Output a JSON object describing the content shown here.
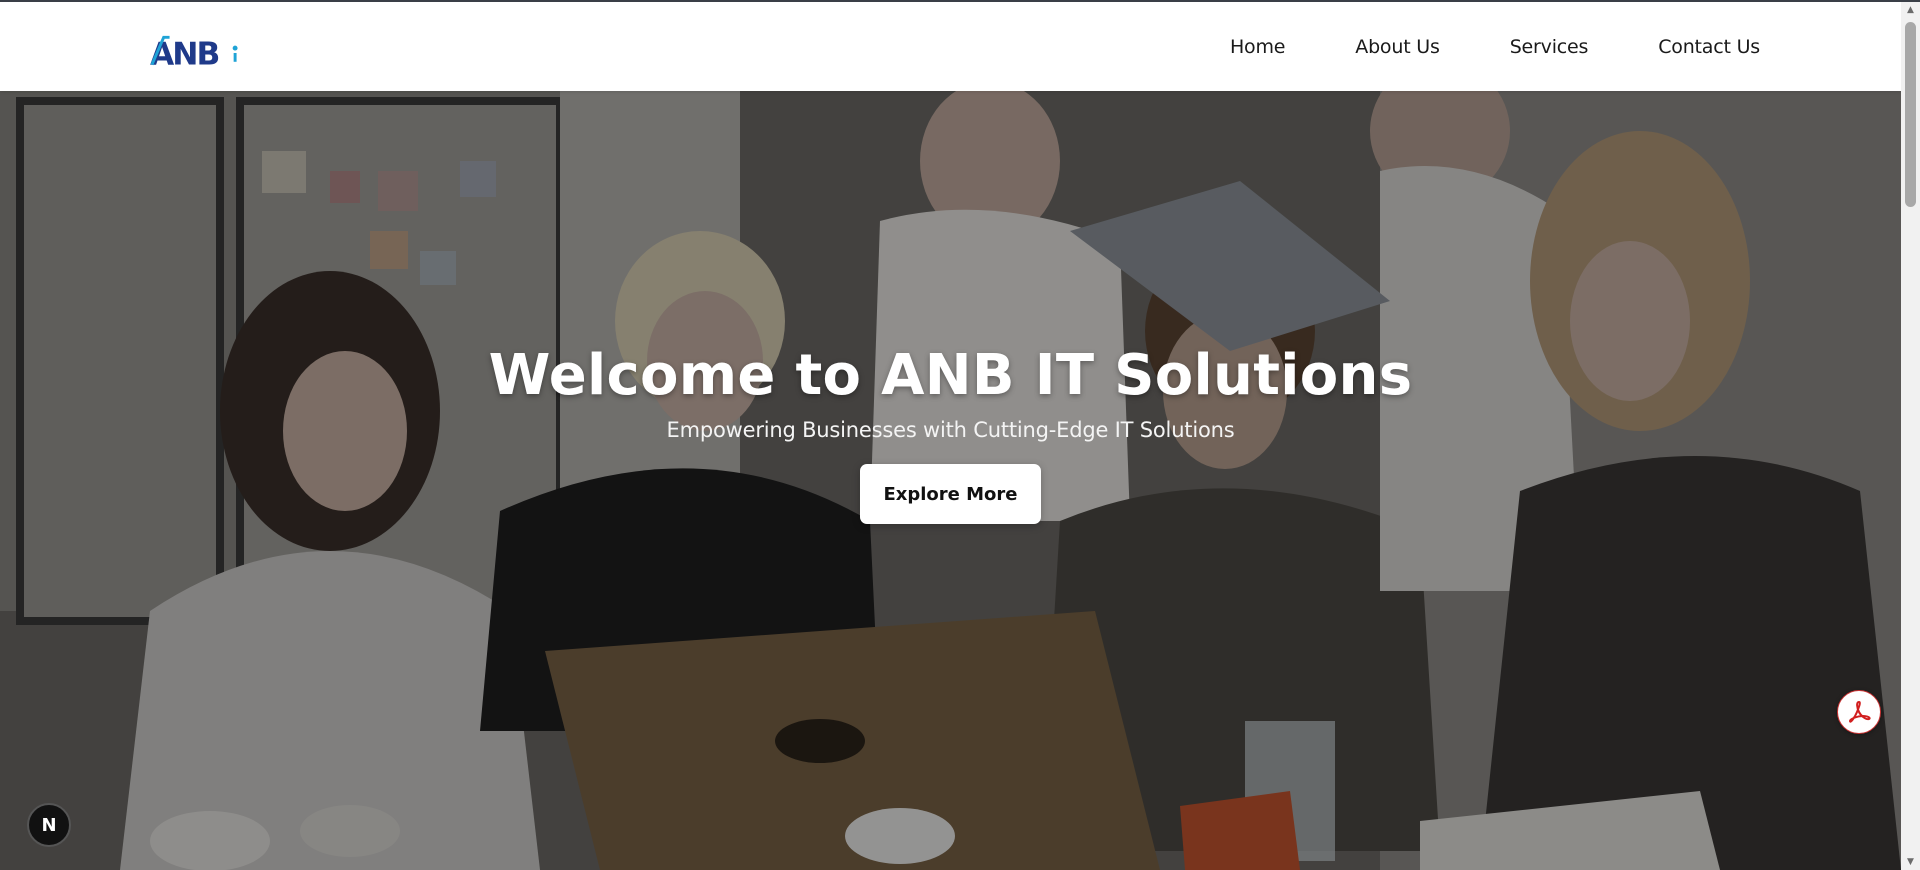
{
  "header": {
    "logo_text": "ANB",
    "nav": [
      {
        "label": "Home"
      },
      {
        "label": "About Us"
      },
      {
        "label": "Services"
      },
      {
        "label": "Contact Us"
      }
    ]
  },
  "hero": {
    "title": "Welcome to ANB IT Solutions",
    "subtitle": "Empowering Businesses with Cutting-Edge IT Solutions",
    "button_label": "Explore More"
  },
  "widgets": {
    "dev_badge_letter": "N",
    "pdf_icon": "pdf-icon"
  },
  "colors": {
    "logo_primary": "#1f3a8a",
    "logo_accent": "#1fa3d6",
    "pdf_red": "#d11f1f"
  }
}
